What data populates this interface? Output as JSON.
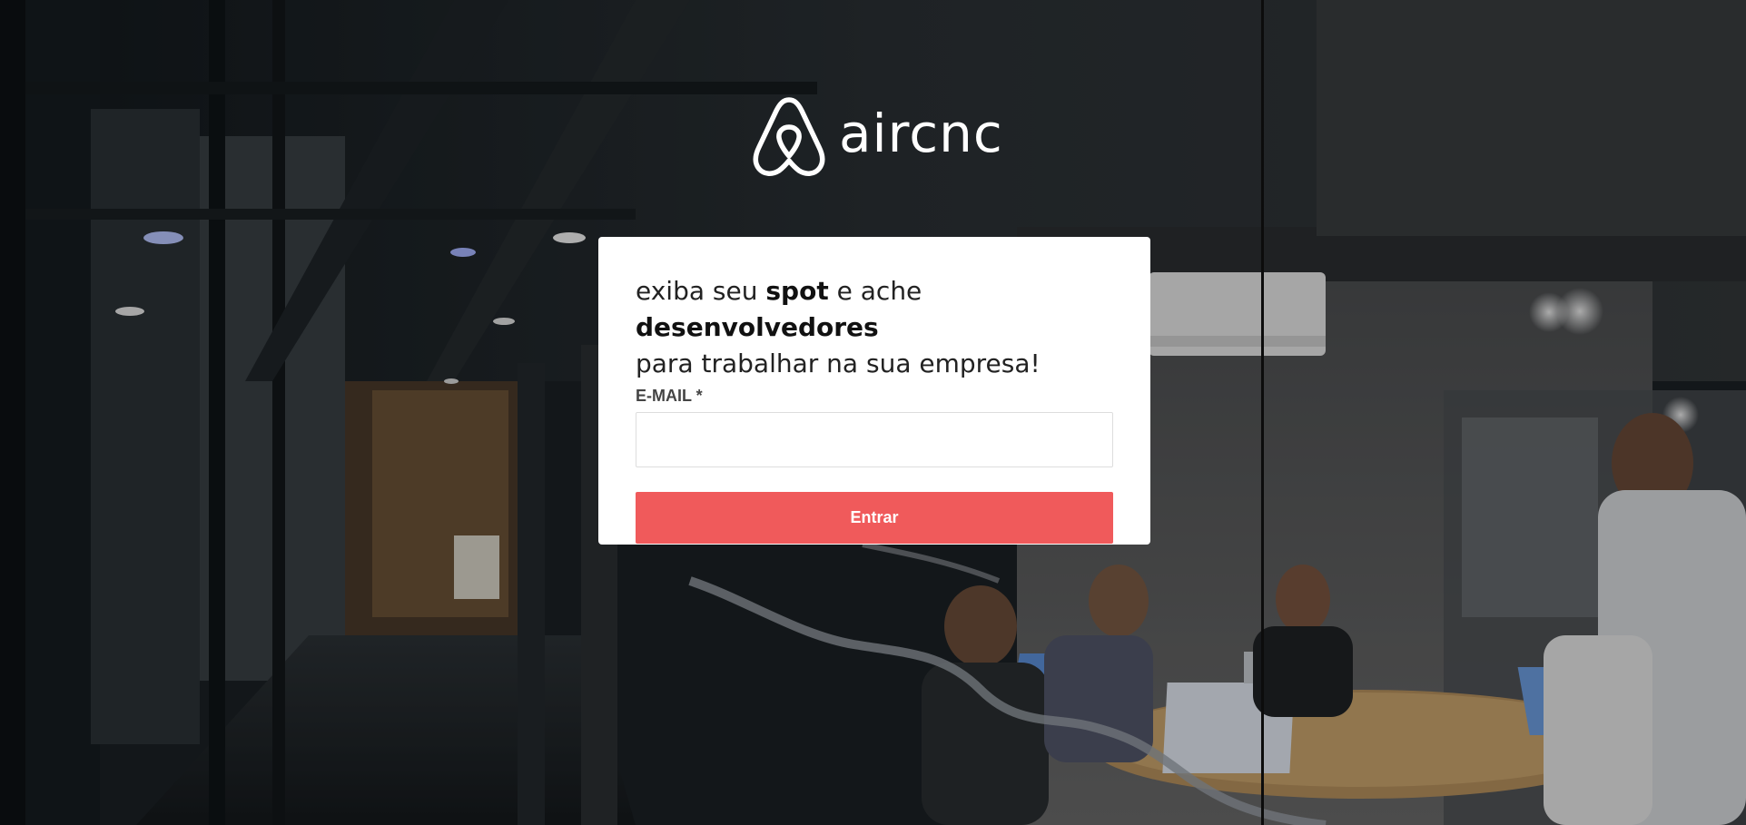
{
  "brand": {
    "name": "aircnc",
    "logo_icon": "airbnb-belo-icon"
  },
  "headline": {
    "part1": "exiba seu ",
    "bold1": "spot",
    "part2": " e ache ",
    "bold2": "desenvolvedores",
    "part3": "para trabalhar na sua empresa!"
  },
  "form": {
    "email_label": "E-MAIL *",
    "email_value": "",
    "submit_label": "Entrar"
  },
  "colors": {
    "accent": "#f05a5b",
    "card_background": "#ffffff",
    "text": "#444444"
  }
}
